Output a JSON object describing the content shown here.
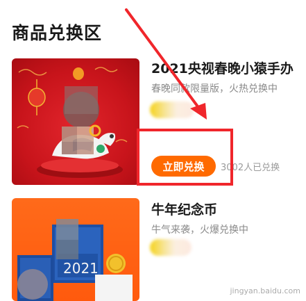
{
  "section": {
    "title": "商品兑换区"
  },
  "products": [
    {
      "name": "2021央视春晚小猿手办",
      "desc": "春晚同款限量版，火热兑换中",
      "button": "立即兑换",
      "redeemed_count": "3002人已兑换"
    },
    {
      "name": "牛年纪念币",
      "desc": "牛气来袭，火爆兑换中"
    }
  ],
  "thumb2": {
    "year_text": "2021"
  },
  "watermark": {
    "text": "jingyan.baidu.com"
  },
  "colors": {
    "accent": "#ff6a00",
    "highlight": "#f0262b",
    "card1_bg": "#d2161c",
    "card2_bg": "#ff6214"
  }
}
